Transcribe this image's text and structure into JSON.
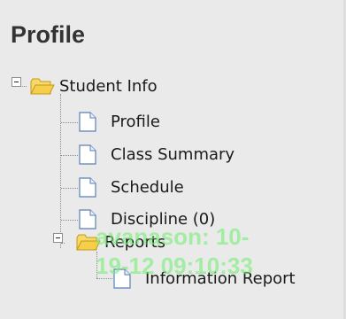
{
  "panel": {
    "title": "Profile"
  },
  "tree": {
    "root": {
      "label": "Student Info",
      "icon": "folder-open-icon",
      "expanded": true
    },
    "items": [
      {
        "label": "Profile",
        "icon": "document-icon"
      },
      {
        "label": "Class Summary",
        "icon": "document-icon"
      },
      {
        "label": "Schedule",
        "icon": "document-icon"
      },
      {
        "label": "Discipline (0)",
        "icon": "document-icon"
      }
    ],
    "reports": {
      "label": "Reports",
      "icon": "folder-open-icon",
      "expanded": true,
      "items": [
        {
          "label": "Information Report",
          "icon": "document-icon"
        }
      ]
    }
  },
  "watermark": {
    "text": "avanason: 10-\n19-12 09:10:33",
    "color": "#78ee78"
  },
  "colors": {
    "panel_bg": "#eaeaea",
    "title": "#333333",
    "folder": "#f5cf4a",
    "document_border": "#5b7fb8"
  }
}
